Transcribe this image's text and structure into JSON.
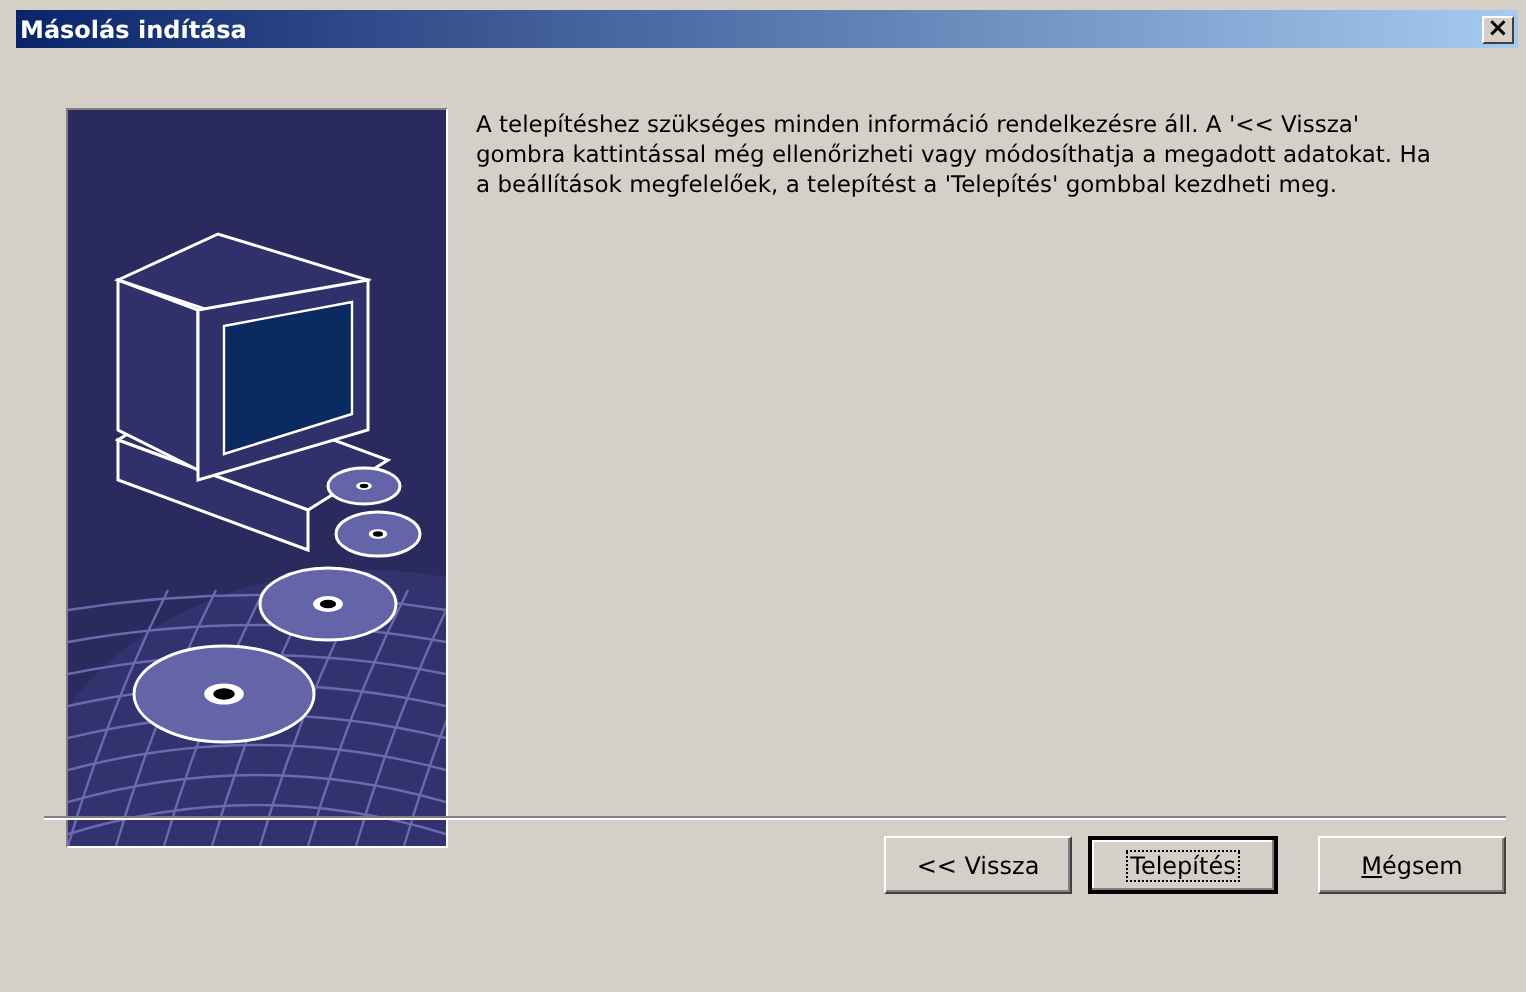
{
  "window": {
    "title": "Másolás indítása",
    "close": "×"
  },
  "message": "A telepítéshez szükséges minden információ rendelkezésre áll. A '<< Vissza' gombra kattintással még ellenőrizheti vagy módosíthatja a megadott adatokat. Ha a beállítások megfelelőek, a telepítést a 'Telepítés' gombbal kezdheti meg.",
  "buttons": [
    {
      "label": "<< Vissza",
      "default": false,
      "underline_first": false
    },
    {
      "label": "Telepítés",
      "default": true,
      "underline_first": false
    },
    {
      "label": "Mégsem",
      "default": false,
      "underline_first": true
    }
  ]
}
